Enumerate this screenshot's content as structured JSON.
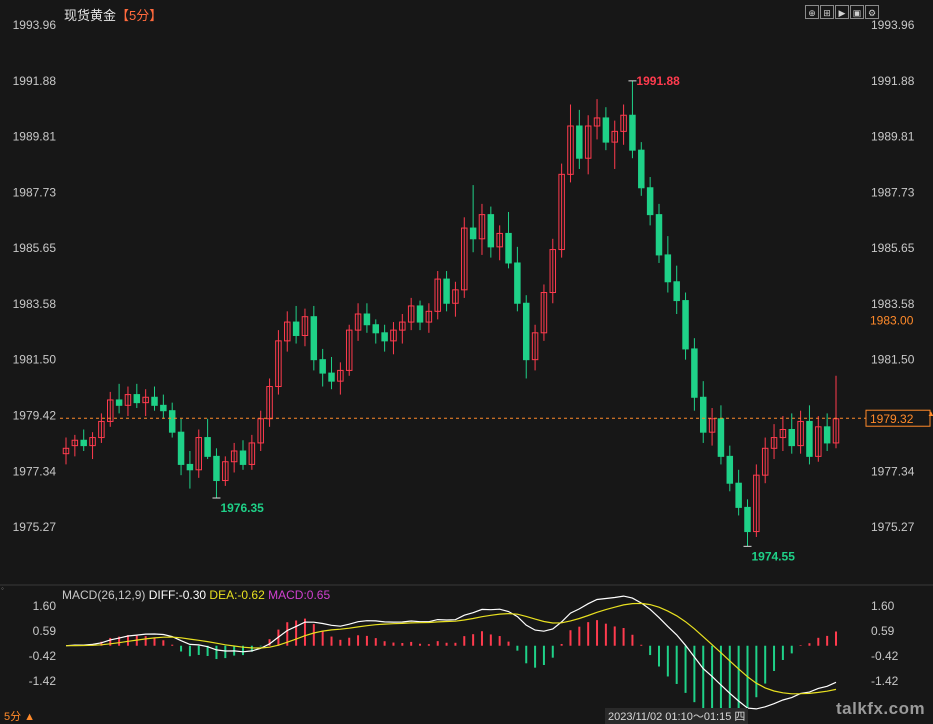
{
  "header": {
    "instrument": "现货黄金",
    "timeframe": "【5分】",
    "tool_icons": [
      "crosshair-icon",
      "grid-icon",
      "play-icon",
      "chart-icon",
      "settings-icon"
    ],
    "tool_glyphs": [
      "⊕",
      "⊞",
      "▶",
      "▣",
      "⚙"
    ]
  },
  "macd": {
    "params": "MACD(26,12,9)",
    "diff": "DIFF:-0.30",
    "dea": "DEA:-0.62",
    "macd": "MACD:0.65",
    "colors": {
      "diff": "#ffffff",
      "dea": "#e8e020",
      "macd": "#d040d0"
    }
  },
  "footer": {
    "timeframe": "5分",
    "time_range": "2023/11/02 01:10～01:15 四",
    "watermark": "talkfx.com"
  },
  "colors": {
    "up": "#ff3b4e",
    "down": "#1fd188",
    "text": "#c8c8c8",
    "label_orange": "#ff8a2a",
    "high_label": "#ff3b4e",
    "low_label": "#1fd188",
    "grid": "#2a2a2a"
  },
  "chart_data": {
    "type": "candlestick",
    "y_ticks": [
      "1993.96",
      "1991.88",
      "1989.81",
      "1987.73",
      "1985.65",
      "1983.58",
      "1981.50",
      "1979.42",
      "1977.34",
      "1975.27"
    ],
    "ylim": [
      1974.2,
      1994.0
    ],
    "price_labels": {
      "current": "1979.32",
      "marker": "1983.00"
    },
    "annotations": {
      "high": "1991.88",
      "low1": "1976.35",
      "low2": "1974.55"
    },
    "current_price": 1979.32,
    "marker_price": 1983.0,
    "high_point": {
      "index": 64,
      "value": 1991.88
    },
    "low_point_1": {
      "index": 17,
      "value": 1976.35
    },
    "low_point_2": {
      "index": 77,
      "value": 1974.55
    },
    "candles": [
      [
        1978.0,
        1978.6,
        1977.6,
        1978.2
      ],
      [
        1978.3,
        1978.7,
        1977.9,
        1978.5
      ],
      [
        1978.5,
        1978.9,
        1978.1,
        1978.3
      ],
      [
        1978.3,
        1978.8,
        1977.8,
        1978.6
      ],
      [
        1978.6,
        1979.5,
        1978.4,
        1979.2
      ],
      [
        1979.2,
        1980.3,
        1979.0,
        1980.0
      ],
      [
        1980.0,
        1980.6,
        1979.5,
        1979.8
      ],
      [
        1979.8,
        1980.5,
        1979.4,
        1980.2
      ],
      [
        1980.2,
        1980.6,
        1979.7,
        1979.9
      ],
      [
        1979.9,
        1980.4,
        1979.4,
        1980.1
      ],
      [
        1980.1,
        1980.5,
        1979.6,
        1979.8
      ],
      [
        1979.8,
        1980.2,
        1979.3,
        1979.6
      ],
      [
        1979.6,
        1979.9,
        1978.6,
        1978.8
      ],
      [
        1978.8,
        1979.3,
        1977.2,
        1977.6
      ],
      [
        1977.6,
        1978.1,
        1976.7,
        1977.4
      ],
      [
        1977.4,
        1978.9,
        1977.1,
        1978.6
      ],
      [
        1978.6,
        1979.3,
        1977.8,
        1977.9
      ],
      [
        1977.9,
        1978.2,
        1976.35,
        1977.0
      ],
      [
        1977.0,
        1977.9,
        1976.8,
        1977.7
      ],
      [
        1977.7,
        1978.4,
        1977.3,
        1978.1
      ],
      [
        1978.1,
        1978.5,
        1977.4,
        1977.6
      ],
      [
        1977.6,
        1978.7,
        1977.4,
        1978.4
      ],
      [
        1978.4,
        1979.6,
        1978.1,
        1979.3
      ],
      [
        1979.3,
        1980.8,
        1979.0,
        1980.5
      ],
      [
        1980.5,
        1982.6,
        1980.2,
        1982.2
      ],
      [
        1982.2,
        1983.3,
        1981.8,
        1982.9
      ],
      [
        1982.9,
        1983.5,
        1982.1,
        1982.4
      ],
      [
        1982.4,
        1983.4,
        1982.0,
        1983.1
      ],
      [
        1983.1,
        1983.5,
        1981.1,
        1981.5
      ],
      [
        1981.5,
        1981.9,
        1980.5,
        1981.0
      ],
      [
        1981.0,
        1981.6,
        1980.4,
        1980.7
      ],
      [
        1980.7,
        1981.4,
        1980.2,
        1981.1
      ],
      [
        1981.1,
        1982.8,
        1980.9,
        1982.6
      ],
      [
        1982.6,
        1983.6,
        1982.2,
        1983.2
      ],
      [
        1983.2,
        1983.6,
        1982.5,
        1982.8
      ],
      [
        1982.8,
        1983.0,
        1982.1,
        1982.5
      ],
      [
        1982.5,
        1982.8,
        1981.8,
        1982.2
      ],
      [
        1982.2,
        1982.9,
        1981.7,
        1982.6
      ],
      [
        1982.6,
        1983.2,
        1982.1,
        1982.9
      ],
      [
        1982.9,
        1983.8,
        1982.6,
        1983.5
      ],
      [
        1983.5,
        1983.7,
        1982.6,
        1982.9
      ],
      [
        1982.9,
        1983.6,
        1982.5,
        1983.3
      ],
      [
        1983.3,
        1984.8,
        1983.0,
        1984.5
      ],
      [
        1984.5,
        1984.8,
        1983.3,
        1983.6
      ],
      [
        1983.6,
        1984.4,
        1983.1,
        1984.1
      ],
      [
        1984.1,
        1986.8,
        1983.8,
        1986.4
      ],
      [
        1986.4,
        1988.0,
        1985.5,
        1986.0
      ],
      [
        1986.0,
        1987.3,
        1985.4,
        1986.9
      ],
      [
        1986.9,
        1987.2,
        1985.3,
        1985.7
      ],
      [
        1985.7,
        1986.5,
        1985.2,
        1986.2
      ],
      [
        1986.2,
        1987.0,
        1984.9,
        1985.1
      ],
      [
        1985.1,
        1985.7,
        1983.3,
        1983.6
      ],
      [
        1983.6,
        1983.9,
        1980.8,
        1981.5
      ],
      [
        1981.5,
        1982.8,
        1981.1,
        1982.5
      ],
      [
        1982.5,
        1984.3,
        1982.2,
        1984.0
      ],
      [
        1984.0,
        1986.0,
        1983.6,
        1985.6
      ],
      [
        1985.6,
        1988.8,
        1985.3,
        1988.4
      ],
      [
        1988.4,
        1991.0,
        1988.1,
        1990.2
      ],
      [
        1990.2,
        1990.8,
        1988.6,
        1989.0
      ],
      [
        1989.0,
        1990.6,
        1988.4,
        1990.2
      ],
      [
        1990.2,
        1991.2,
        1989.7,
        1990.5
      ],
      [
        1990.5,
        1990.9,
        1989.3,
        1989.6
      ],
      [
        1989.6,
        1990.4,
        1988.6,
        1990.0
      ],
      [
        1990.0,
        1991.0,
        1989.5,
        1990.6
      ],
      [
        1990.6,
        1991.88,
        1989.0,
        1989.3
      ],
      [
        1989.3,
        1989.6,
        1987.6,
        1987.9
      ],
      [
        1987.9,
        1988.3,
        1986.5,
        1986.9
      ],
      [
        1986.9,
        1987.3,
        1985.1,
        1985.4
      ],
      [
        1985.4,
        1986.1,
        1984.0,
        1984.4
      ],
      [
        1984.4,
        1985.0,
        1983.2,
        1983.7
      ],
      [
        1983.7,
        1984.0,
        1981.5,
        1981.9
      ],
      [
        1981.9,
        1982.3,
        1979.6,
        1980.1
      ],
      [
        1980.1,
        1980.7,
        1978.4,
        1978.8
      ],
      [
        1978.8,
        1979.7,
        1978.3,
        1979.3
      ],
      [
        1979.3,
        1979.8,
        1977.6,
        1977.9
      ],
      [
        1977.9,
        1978.3,
        1976.6,
        1976.9
      ],
      [
        1976.9,
        1977.4,
        1975.7,
        1976.0
      ],
      [
        1976.0,
        1976.3,
        1974.55,
        1975.1
      ],
      [
        1975.1,
        1977.6,
        1974.9,
        1977.2
      ],
      [
        1977.2,
        1978.6,
        1976.9,
        1978.2
      ],
      [
        1978.2,
        1979.1,
        1977.8,
        1978.6
      ],
      [
        1978.6,
        1979.4,
        1978.1,
        1978.9
      ],
      [
        1978.9,
        1979.5,
        1978.0,
        1978.3
      ],
      [
        1978.3,
        1979.6,
        1978.0,
        1979.2
      ],
      [
        1979.2,
        1979.8,
        1977.6,
        1977.9
      ],
      [
        1977.9,
        1979.4,
        1977.7,
        1979.0
      ],
      [
        1979.0,
        1979.5,
        1978.1,
        1978.4
      ],
      [
        1978.4,
        1980.9,
        1978.2,
        1979.3
      ]
    ],
    "macd_y_ticks": [
      "1.60",
      "0.59",
      "-0.42",
      "-1.42"
    ],
    "macd_ylim": [
      -2.1,
      1.9
    ]
  }
}
